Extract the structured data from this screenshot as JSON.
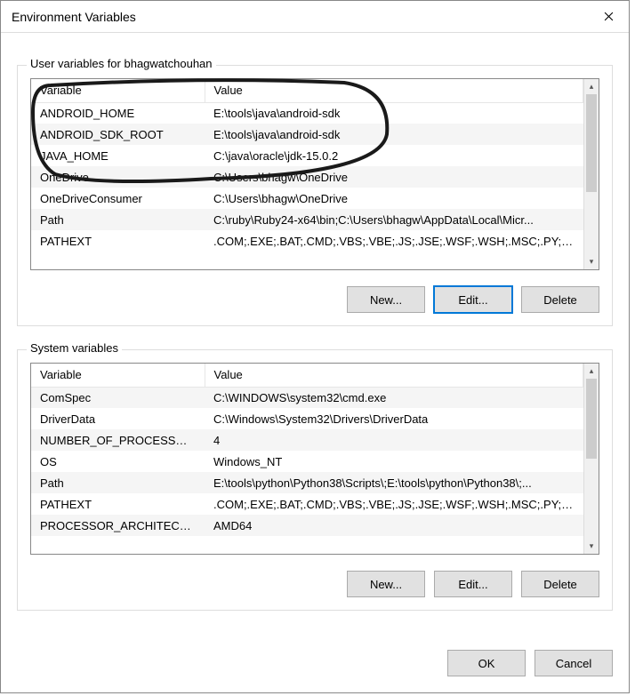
{
  "title": "Environment Variables",
  "user_section": {
    "label": "User variables for bhagwatchouhan",
    "headers": {
      "variable": "Variable",
      "value": "Value"
    },
    "rows": [
      {
        "variable": "ANDROID_HOME",
        "value": "E:\\tools\\java\\android-sdk"
      },
      {
        "variable": "ANDROID_SDK_ROOT",
        "value": "E:\\tools\\java\\android-sdk"
      },
      {
        "variable": "JAVA_HOME",
        "value": "C:\\java\\oracle\\jdk-15.0.2"
      },
      {
        "variable": "OneDrive",
        "value": "C:\\Users\\bhagw\\OneDrive"
      },
      {
        "variable": "OneDriveConsumer",
        "value": "C:\\Users\\bhagw\\OneDrive"
      },
      {
        "variable": "Path",
        "value": "C:\\ruby\\Ruby24-x64\\bin;C:\\Users\\bhagw\\AppData\\Local\\Micr..."
      },
      {
        "variable": "PATHEXT",
        "value": ".COM;.EXE;.BAT;.CMD;.VBS;.VBE;.JS;.JSE;.WSF;.WSH;.MSC;.PY;.PY..."
      }
    ],
    "buttons": {
      "new": "New...",
      "edit": "Edit...",
      "delete": "Delete"
    }
  },
  "system_section": {
    "label": "System variables",
    "headers": {
      "variable": "Variable",
      "value": "Value"
    },
    "rows": [
      {
        "variable": "ComSpec",
        "value": "C:\\WINDOWS\\system32\\cmd.exe"
      },
      {
        "variable": "DriverData",
        "value": "C:\\Windows\\System32\\Drivers\\DriverData"
      },
      {
        "variable": "NUMBER_OF_PROCESSORS",
        "value": "4"
      },
      {
        "variable": "OS",
        "value": "Windows_NT"
      },
      {
        "variable": "Path",
        "value": "E:\\tools\\python\\Python38\\Scripts\\;E:\\tools\\python\\Python38\\;..."
      },
      {
        "variable": "PATHEXT",
        "value": ".COM;.EXE;.BAT;.CMD;.VBS;.VBE;.JS;.JSE;.WSF;.WSH;.MSC;.PY;.PYW"
      },
      {
        "variable": "PROCESSOR_ARCHITECTU...",
        "value": "AMD64"
      }
    ],
    "buttons": {
      "new": "New...",
      "edit": "Edit...",
      "delete": "Delete"
    }
  },
  "dialog_buttons": {
    "ok": "OK",
    "cancel": "Cancel"
  }
}
